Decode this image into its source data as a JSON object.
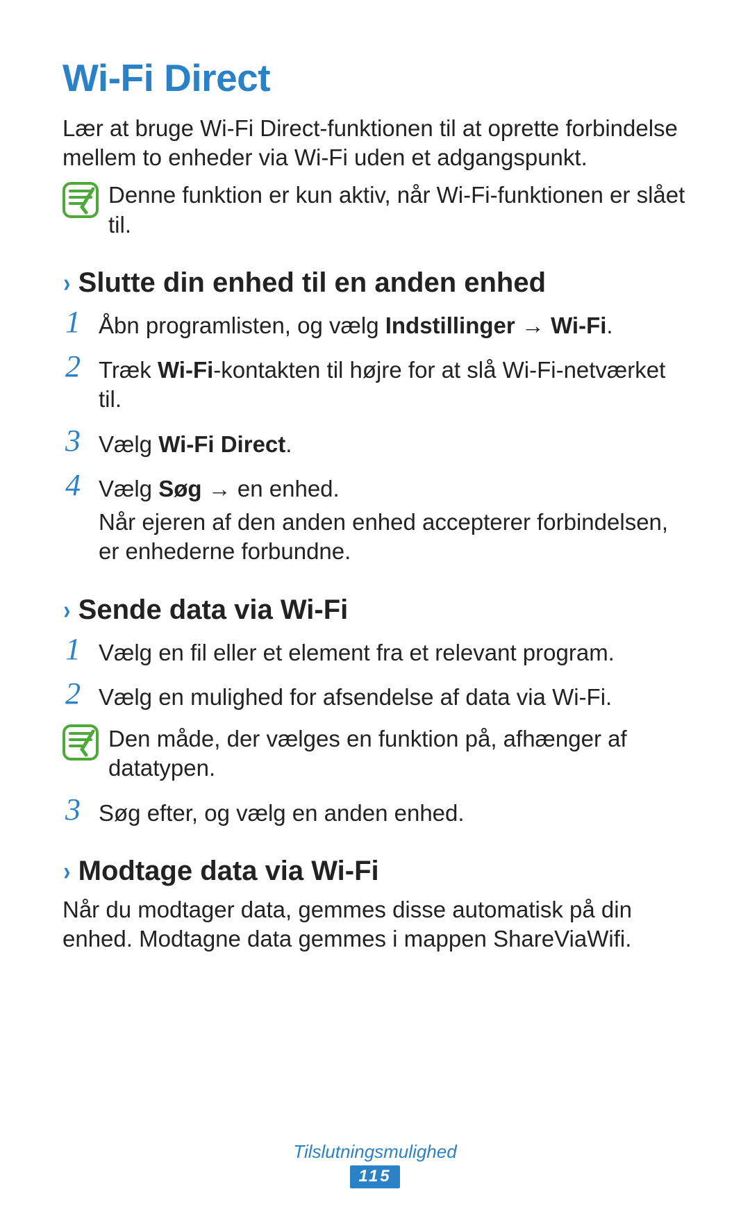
{
  "h1": "Wi-Fi Direct",
  "intro": "Lær at bruge Wi-Fi Direct-funktionen til at oprette forbindelse mellem to enheder via Wi-Fi uden et adgangspunkt.",
  "note1": "Denne funktion er kun aktiv, når Wi-Fi-funktionen er slået til.",
  "section1": {
    "title": "Slutte din enhed til en anden enhed",
    "step1_pre": "Åbn programlisten, og vælg ",
    "step1_b1": "Indstillinger",
    "step1_arrow": " → ",
    "step1_b2": "Wi-Fi",
    "step1_post": ".",
    "step2_pre": "Træk ",
    "step2_b1": "Wi-Fi",
    "step2_post": "-kontakten til højre for at slå Wi-Fi-netværket til.",
    "step3_pre": "Vælg ",
    "step3_b1": "Wi-Fi Direct",
    "step3_post": ".",
    "step4_pre": "Vælg ",
    "step4_b1": "Søg",
    "step4_arrow": " → ",
    "step4_post": "en enhed.",
    "step4_line2": "Når ejeren af den anden enhed accepterer forbindelsen, er enhederne forbundne."
  },
  "section2": {
    "title": "Sende data via Wi-Fi",
    "step1": "Vælg en fil eller et element fra et relevant program.",
    "step2": "Vælg en mulighed for afsendelse af data via Wi-Fi.",
    "note": "Den måde, der vælges en funktion på, afhænger af datatypen.",
    "step3": "Søg efter, og vælg en anden enhed."
  },
  "section3": {
    "title": "Modtage data via Wi-Fi",
    "body": "Når du modtager data, gemmes disse automatisk på din enhed. Modtagne data gemmes i mappen ShareViaWifi."
  },
  "footer": {
    "section": "Tilslutningsmulighed",
    "page": "115"
  },
  "nums": {
    "n1": "1",
    "n2": "2",
    "n3": "3",
    "n4": "4"
  },
  "chev": "›"
}
